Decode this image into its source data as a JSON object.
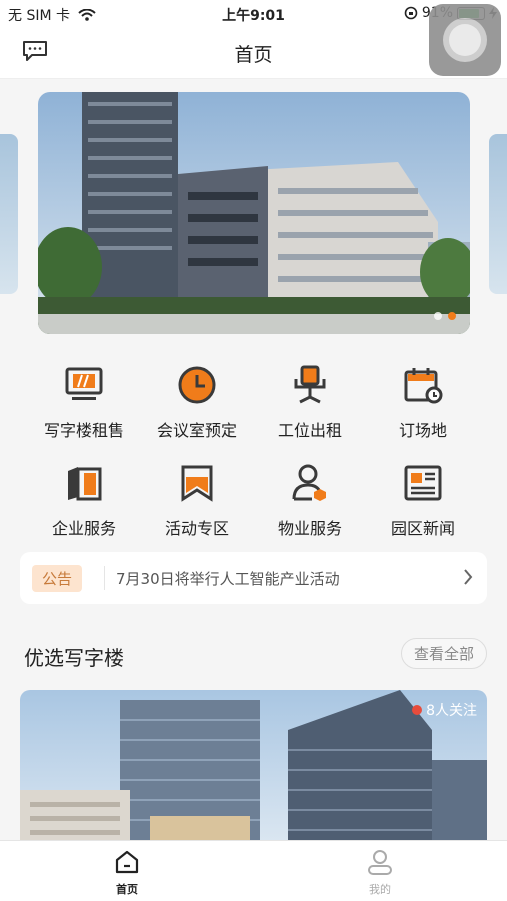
{
  "status": {
    "carrier": "无 SIM 卡",
    "time": "上午9:01",
    "battery": "91%",
    "battery_level": 0.91
  },
  "nav": {
    "title": "首页",
    "message_icon": "message-icon"
  },
  "banner": {
    "dots": 2,
    "active_dot": 1
  },
  "grid": [
    {
      "label": "写字楼租售",
      "icon": "office-sale-icon"
    },
    {
      "label": "会议室预定",
      "icon": "clock-icon"
    },
    {
      "label": "工位出租",
      "icon": "chair-icon"
    },
    {
      "label": "订场地",
      "icon": "calendar-icon"
    },
    {
      "label": "企业服务",
      "icon": "book-icon"
    },
    {
      "label": "活动专区",
      "icon": "bookmark-icon"
    },
    {
      "label": "物业服务",
      "icon": "person-icon"
    },
    {
      "label": "园区新闻",
      "icon": "news-icon"
    }
  ],
  "notice": {
    "tag": "公告",
    "text": "7月30日将举行人工智能产业活动"
  },
  "section": {
    "title": "优选写字楼",
    "view_all": "查看全部"
  },
  "card": {
    "followers": "8人关注"
  },
  "tabs": [
    {
      "label": "首页",
      "active": true
    },
    {
      "label": "我的",
      "active": false
    }
  ],
  "colors": {
    "accent": "#f07c1a",
    "dark": "#3a3a3a"
  }
}
